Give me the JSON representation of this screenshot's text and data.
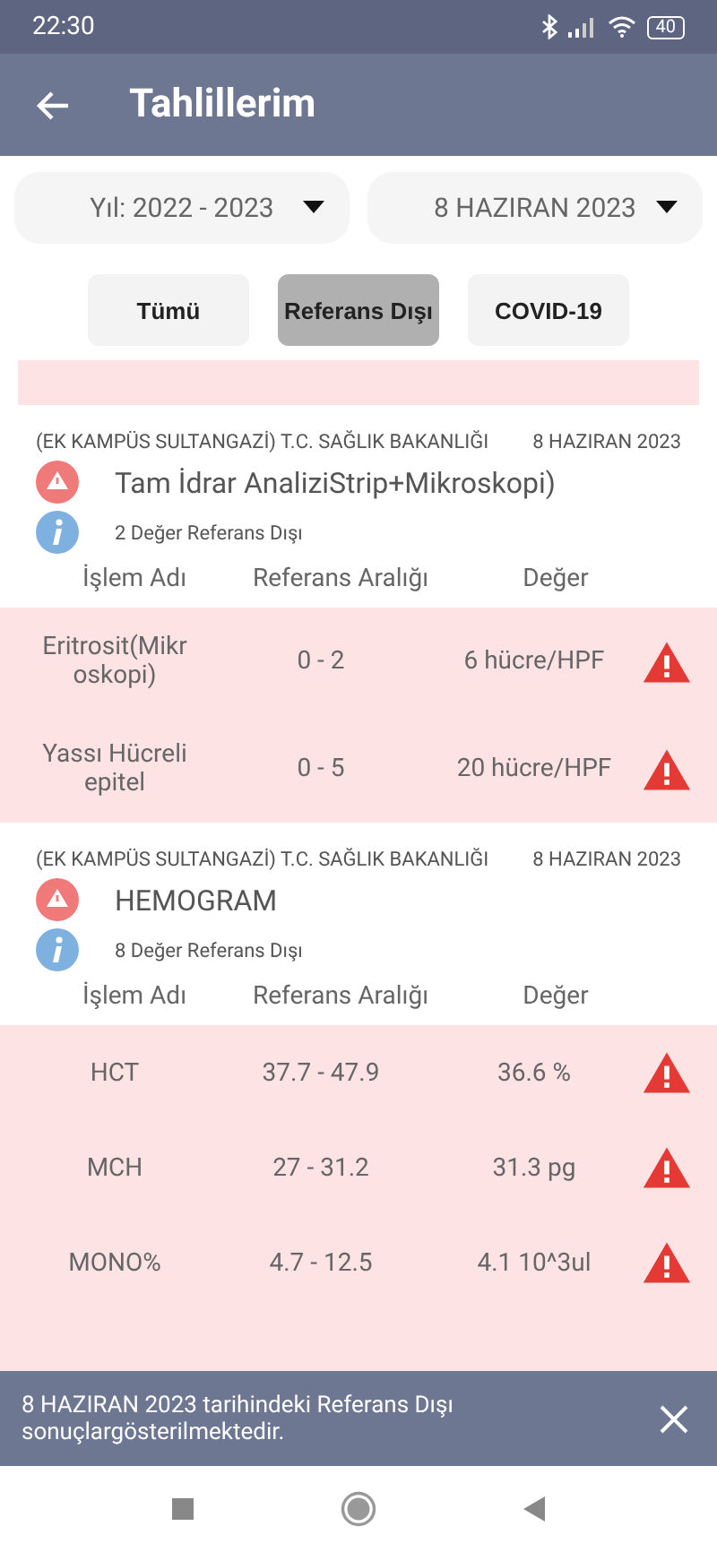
{
  "status_bar": {
    "time": "22:30",
    "battery": "40"
  },
  "header": {
    "title": "Tahlillerim"
  },
  "filters": [
    {
      "value": "Yıl: 2022 - 2023"
    },
    {
      "value": "8 HAZIRAN 2023"
    }
  ],
  "tabs": [
    {
      "label": "Tümü",
      "selected": false
    },
    {
      "label": "Referans Dışı",
      "selected": true
    },
    {
      "label": "COVID-19",
      "selected": false
    }
  ],
  "sections": [
    {
      "facility": "(EK KAMPÜS SULTANGAZİ) T.C. SAĞLIK BAKANLIĞI",
      "date": "8 HAZIRAN 2023",
      "title": "Tam İdrar AnaliziStrip+Mikroskopi)",
      "summary": "2 Değer Referans Dışı",
      "columns": [
        "İşlem Adı",
        "Referans Aralığı",
        "Değer"
      ],
      "rows": [
        {
          "name": "Eritrosit(Mikroskopi)",
          "range": "0 - 2",
          "value": "6 hücre/HPF",
          "out_of_range": true
        },
        {
          "name": "Yassı Hücreli epitel",
          "range": "0 - 5",
          "value": "20 hücre/HPF",
          "out_of_range": true
        }
      ]
    },
    {
      "facility": "(EK KAMPÜS SULTANGAZİ) T.C. SAĞLIK BAKANLIĞI",
      "date": "8 HAZIRAN 2023",
      "title": "HEMOGRAM",
      "summary": "8 Değer Referans Dışı",
      "columns": [
        "İşlem Adı",
        "Referans Aralığı",
        "Değer"
      ],
      "rows": [
        {
          "name": "HCT",
          "range": "37.7 - 47.9",
          "value": "36.6 %",
          "out_of_range": true
        },
        {
          "name": "MCH",
          "range": "27 - 31.2",
          "value": "31.3 pg",
          "out_of_range": true
        },
        {
          "name": "MONO%",
          "range": "4.7 - 12.5",
          "value": "4.1 10^3ul",
          "out_of_range": true
        }
      ]
    }
  ],
  "snackbar": {
    "message": "8 HAZIRAN 2023 tarihindeki Referans Dışı sonuçlargösterilmektedir."
  }
}
